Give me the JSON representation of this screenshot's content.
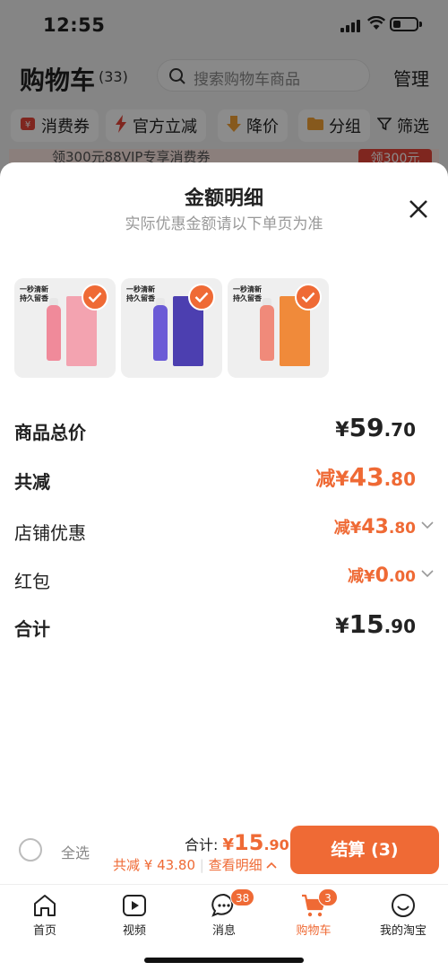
{
  "status_bar": {
    "time": "12:55"
  },
  "header": {
    "title": "购物车",
    "count": "(33)",
    "search_placeholder": "搜索购物车商品",
    "manage": "管理"
  },
  "filter_chips": [
    {
      "label": "消费券",
      "icon": "coupon-icon"
    },
    {
      "label": "官方立减",
      "icon": "lightning-icon"
    },
    {
      "label": "降价",
      "icon": "price-drop-icon"
    },
    {
      "label": "分组",
      "icon": "folder-icon"
    },
    {
      "label": "筛选",
      "icon": "filter-icon"
    }
  ],
  "promo_banner": {
    "text": "领300元88VIP专享消费券",
    "button": "领300元"
  },
  "sheet": {
    "title": "金额明细",
    "subtitle": "实际优惠金额请以下单页为准",
    "products": [
      {
        "headline": "一秒清新\n持久留香",
        "bottle_color": "#f08a9a",
        "box_color": "#f3a3b0",
        "selected": true
      },
      {
        "headline": "一秒清新\n持久留香",
        "bottle_color": "#6b5bd6",
        "box_color": "#4c3fb0",
        "selected": true
      },
      {
        "headline": "一秒清新\n持久留香",
        "bottle_color": "#f08a7a",
        "box_color": "#f08a3a",
        "selected": true
      }
    ],
    "rows": [
      {
        "label": "商品总价",
        "prefix": "",
        "sym": "¥",
        "int": "59",
        "dec": ".70",
        "bold": true,
        "orange": false,
        "chevron": false
      },
      {
        "label": "共减",
        "prefix": "减",
        "sym": "¥",
        "int": "43",
        "dec": ".80",
        "bold": true,
        "orange": true,
        "chevron": false
      },
      {
        "label": "店铺优惠",
        "prefix": "减",
        "sym": "¥",
        "int": "43",
        "dec": ".80",
        "bold": false,
        "orange": true,
        "chevron": true
      },
      {
        "label": "红包",
        "prefix": "减",
        "sym": "¥",
        "int": "0",
        "dec": ".00",
        "bold": false,
        "orange": true,
        "chevron": true
      },
      {
        "label": "合计",
        "prefix": "",
        "sym": "¥",
        "int": "15",
        "dec": ".90",
        "bold": true,
        "orange": false,
        "chevron": false
      }
    ]
  },
  "bottom_bar": {
    "select_all": "全选",
    "total_label": "合计:",
    "total_sym": "¥",
    "total_int": "15",
    "total_dec": ".90",
    "saved": "共减 ¥ 43.80",
    "details": "查看明细",
    "checkout": "结算 (3)"
  },
  "tabs": [
    {
      "label": "首页",
      "icon": "home-icon",
      "active": false,
      "badge": ""
    },
    {
      "label": "视频",
      "icon": "video-icon",
      "active": false,
      "badge": ""
    },
    {
      "label": "消息",
      "icon": "message-icon",
      "active": false,
      "badge": "38"
    },
    {
      "label": "购物车",
      "icon": "cart-icon",
      "active": true,
      "badge": "3"
    },
    {
      "label": "我的淘宝",
      "icon": "profile-icon",
      "active": false,
      "badge": ""
    }
  ],
  "colors": {
    "accent": "#ef6a35",
    "background": "#f3f3f3"
  }
}
